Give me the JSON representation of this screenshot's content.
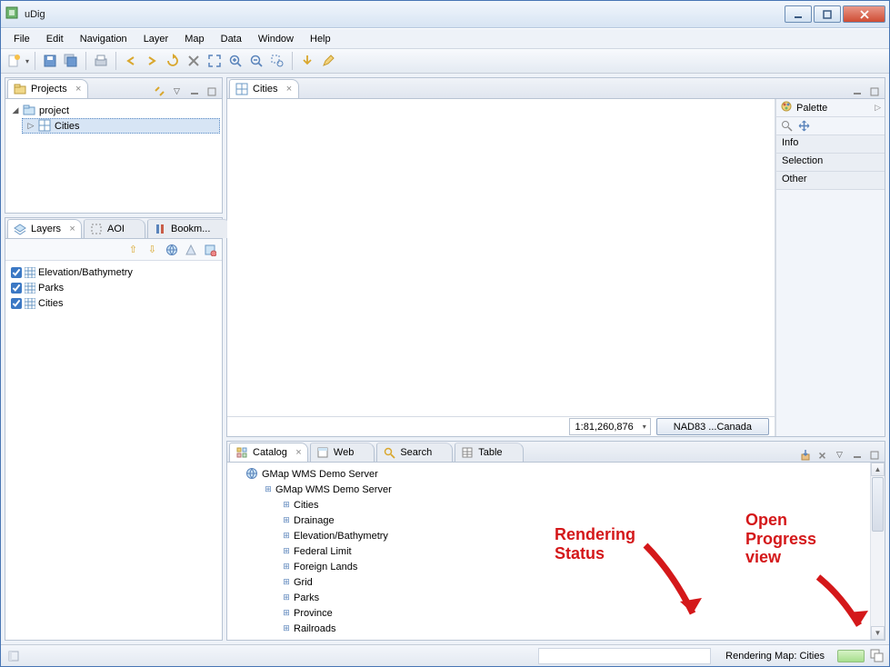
{
  "window": {
    "title": "uDig"
  },
  "menu": {
    "items": [
      "File",
      "Edit",
      "Navigation",
      "Layer",
      "Map",
      "Data",
      "Window",
      "Help"
    ]
  },
  "projects": {
    "tab_label": "Projects",
    "root": "project",
    "children": [
      "Cities"
    ]
  },
  "layers": {
    "tabs": {
      "layers": "Layers",
      "aoi": "AOI",
      "bookmarks": "Bookm..."
    },
    "items": [
      "Elevation/Bathymetry",
      "Parks",
      "Cities"
    ]
  },
  "map": {
    "tab_label": "Cities",
    "scale": "1:81,260,876",
    "crs": "NAD83 ...Canada"
  },
  "palette": {
    "title": "Palette",
    "sections": [
      "Info",
      "Selection",
      "Other"
    ]
  },
  "catalog": {
    "tabs": {
      "catalog": "Catalog",
      "web": "Web",
      "search": "Search",
      "table": "Table"
    },
    "root": "GMap WMS Demo Server",
    "child": "GMap WMS Demo Server",
    "layers": [
      "Cities",
      "Drainage",
      "Elevation/Bathymetry",
      "Federal Limit",
      "Foreign Lands",
      "Grid",
      "Parks",
      "Province",
      "Railroads"
    ]
  },
  "status": {
    "rendering": "Rendering Map: Cities"
  },
  "annot": {
    "rendering": "Rendering\nStatus",
    "progress": "Open\nProgress\nview"
  }
}
